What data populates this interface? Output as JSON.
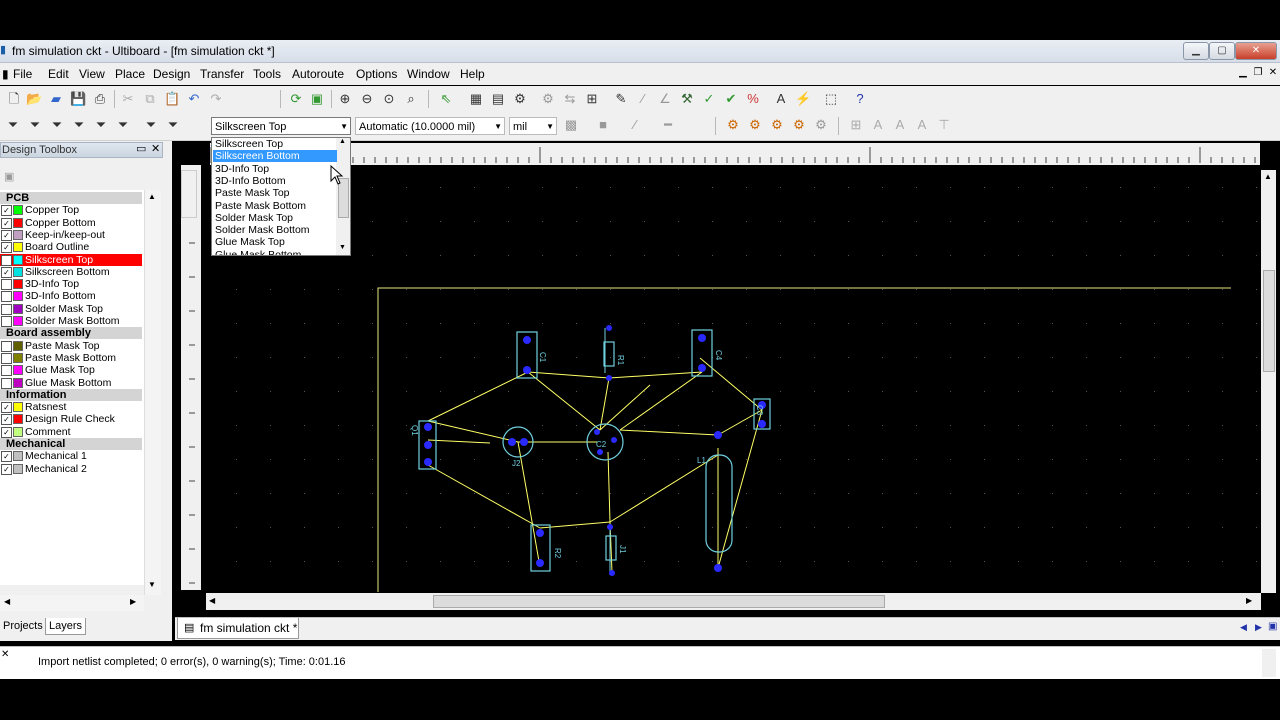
{
  "window": {
    "title": "fm simulation ckt - Ultiboard - [fm simulation ckt *]"
  },
  "menu": [
    "File",
    "Edit",
    "View",
    "Place",
    "Design",
    "Transfer",
    "Tools",
    "Autoroute",
    "Options",
    "Window",
    "Help"
  ],
  "toolbar": {
    "layer_select": "Silkscreen Top",
    "grid_select": "Automatic (10.0000 mil)",
    "unit_select": "mil"
  },
  "dropdown": {
    "options": [
      "Silkscreen Top",
      "Silkscreen Bottom",
      "3D-Info Top",
      "3D-Info Bottom",
      "Paste Mask Top",
      "Paste Mask Bottom",
      "Solder Mask Top",
      "Solder Mask Bottom",
      "Glue Mask Top",
      "Glue Mask Bottom"
    ],
    "highlighted": 1
  },
  "toolbox": {
    "title": "Design Toolbox",
    "groups": [
      {
        "name": "PCB",
        "layers": [
          {
            "label": "Copper Top",
            "color": "#00ff00",
            "checked": true
          },
          {
            "label": "Copper Bottom",
            "color": "#ff0000",
            "checked": true
          },
          {
            "label": "Keep-in/keep-out",
            "color": "#c0a0c0",
            "checked": true
          },
          {
            "label": "Board Outline",
            "color": "#ffff00",
            "checked": true
          },
          {
            "label": "Silkscreen Top",
            "color": "#00ffff",
            "checked": true,
            "selected": true
          },
          {
            "label": "Silkscreen Bottom",
            "color": "#00e0e0",
            "checked": true
          },
          {
            "label": "3D-Info Top",
            "color": "#ff0000",
            "checked": false
          },
          {
            "label": "3D-Info Bottom",
            "color": "#ff00ff",
            "checked": false
          },
          {
            "label": "Solder Mask Top",
            "color": "#a000c0",
            "checked": false
          },
          {
            "label": "Solder Mask Bottom",
            "color": "#ff00ff",
            "checked": false
          }
        ]
      },
      {
        "name": "Board assembly",
        "layers": [
          {
            "label": "Paste Mask Top",
            "color": "#606000",
            "checked": false
          },
          {
            "label": "Paste Mask Bottom",
            "color": "#808000",
            "checked": false
          },
          {
            "label": "Glue Mask Top",
            "color": "#ff00ff",
            "checked": false
          },
          {
            "label": "Glue Mask Bottom",
            "color": "#c000c0",
            "checked": false
          }
        ]
      },
      {
        "name": "Information",
        "layers": [
          {
            "label": "Ratsnest",
            "color": "#ffff00",
            "checked": true
          },
          {
            "label": "Design Rule Check",
            "color": "#ff0000",
            "checked": true
          },
          {
            "label": "Comment",
            "color": "#c0ff80",
            "checked": true
          }
        ]
      },
      {
        "name": "Mechanical",
        "layers": [
          {
            "label": "Mechanical 1",
            "color": "#c0c0c0",
            "checked": true
          },
          {
            "label": "Mechanical 2",
            "color": "#c0c0c0",
            "checked": true
          }
        ]
      }
    ],
    "tabs": [
      "Projects",
      "Layers"
    ]
  },
  "document_tab": "fm simulation ckt *",
  "status": "Import netlist completed;  0 error(s), 0 warning(s);  Time: 0:01.16",
  "components": [
    "C1",
    "R1",
    "C4",
    "C3",
    "Q1",
    "C2",
    "R2",
    "J1",
    "J2",
    "L1"
  ]
}
